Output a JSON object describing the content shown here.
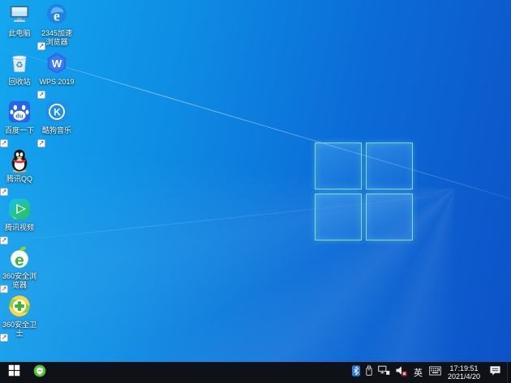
{
  "desktop": {
    "icons": [
      {
        "id": "this-pc",
        "label": "此电脑",
        "shortcut": false
      },
      {
        "id": "2345-browser",
        "label": "2345加速浏览器",
        "shortcut": true
      },
      {
        "id": "recycle-bin",
        "label": "回收站",
        "shortcut": false
      },
      {
        "id": "wps-2019",
        "label": "WPS 2019",
        "shortcut": true
      },
      {
        "id": "baidu-search",
        "label": "百度一下",
        "shortcut": true
      },
      {
        "id": "kugou-music",
        "label": "酷狗音乐",
        "shortcut": true
      },
      {
        "id": "tencent-qq",
        "label": "腾讯QQ",
        "shortcut": true
      },
      {
        "id": "tencent-video",
        "label": "腾讯视频",
        "shortcut": true
      },
      {
        "id": "360-browser",
        "label": "360安全浏览器",
        "shortcut": true
      },
      {
        "id": "360-safe-guard",
        "label": "360安全卫士",
        "shortcut": true
      }
    ],
    "shortcut_arrow": "↗"
  },
  "taskbar": {
    "start": {
      "icon": "windows-logo"
    },
    "pinned": [
      {
        "id": "360-safe-tray",
        "icon": "green-circle-shield"
      }
    ],
    "tray": {
      "icons": [
        "bluetooth-icon",
        "usb-device-icon",
        "network-icon",
        "volume-muted-icon",
        "touch-keyboard-icon"
      ],
      "ime_label": "英",
      "clock": {
        "time": "17:19:51",
        "date": "2021/4/20"
      }
    }
  },
  "colors": {
    "wallpaper_light": "#14a7ef",
    "wallpaper_dark": "#0d52c8",
    "taskbar_bg": "#0e1117",
    "bluetooth_blue": "#2e7cd6",
    "mute_red": "#c42222"
  }
}
